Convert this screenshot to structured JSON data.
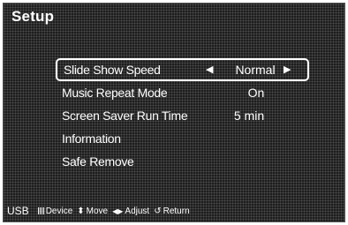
{
  "header": {
    "title": "Setup"
  },
  "menu": {
    "items": [
      {
        "label": "Slide Show Speed",
        "value": "Normal",
        "selected": true
      },
      {
        "label": "Music Repeat Mode",
        "value": "On"
      },
      {
        "label": "Screen Saver Run Time",
        "value": "5 min"
      },
      {
        "label": "Information",
        "value": ""
      },
      {
        "label": "Safe Remove",
        "value": ""
      }
    ]
  },
  "footer": {
    "source": "USB",
    "hints": [
      {
        "icon": "device-icon",
        "label": "Device"
      },
      {
        "icon": "move-icon",
        "label": "Move"
      },
      {
        "icon": "adjust-icon",
        "label": "Adjust"
      },
      {
        "icon": "return-icon",
        "label": "Return"
      }
    ]
  }
}
